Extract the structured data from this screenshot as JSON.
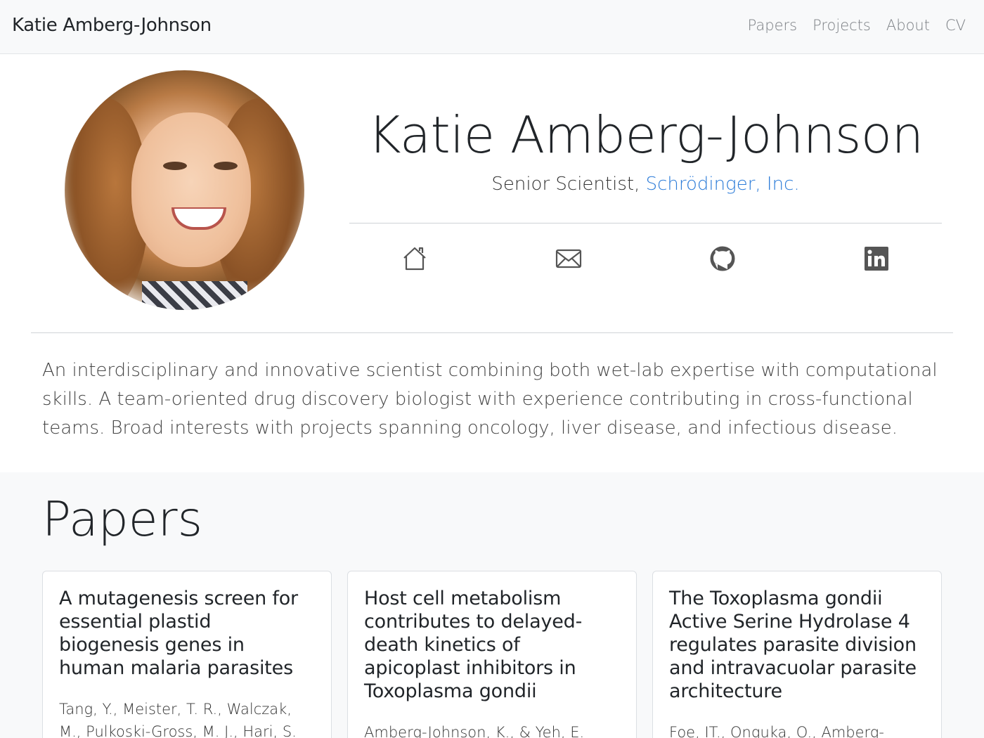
{
  "navbar": {
    "brand": "Katie Amberg-Johnson",
    "links": [
      "Papers",
      "Projects",
      "About",
      "CV"
    ]
  },
  "profile": {
    "name": "Katie Amberg-Johnson",
    "title_prefix": "Senior Scientist, ",
    "company": "Schrödinger, Inc.",
    "accent_color": "#2b7bd8",
    "icons": [
      "home-icon",
      "email-icon",
      "github-icon",
      "linkedin-icon"
    ]
  },
  "bio": "An interdisciplinary and innovative scientist combining both wet-lab expertise with computational skills. A team-oriented drug discovery biologist with experience contributing in cross-functional teams. Broad interests with projects spanning oncology, liver disease, and infectious disease.",
  "papers": {
    "heading": "Papers",
    "items": [
      {
        "title": "A mutagenesis screen for essential plastid biogenesis genes in human malaria parasites",
        "authors": "Tang, Y., Meister, T. R., Walczak, M., Pulkoski-Gross, M. J., Hari, S. B.,"
      },
      {
        "title": "Host cell metabolism contributes to delayed-death kinetics of apicoplast inhibitors in Toxoplasma gondii",
        "authors": "Amberg-Johnson, K., & Yeh, E."
      },
      {
        "title": "The Toxoplasma gondii Active Serine Hydrolase 4 regulates parasite division and intravacuolar parasite architecture",
        "authors": "Foe, IT., Onguka, O., Amberg-"
      }
    ]
  }
}
